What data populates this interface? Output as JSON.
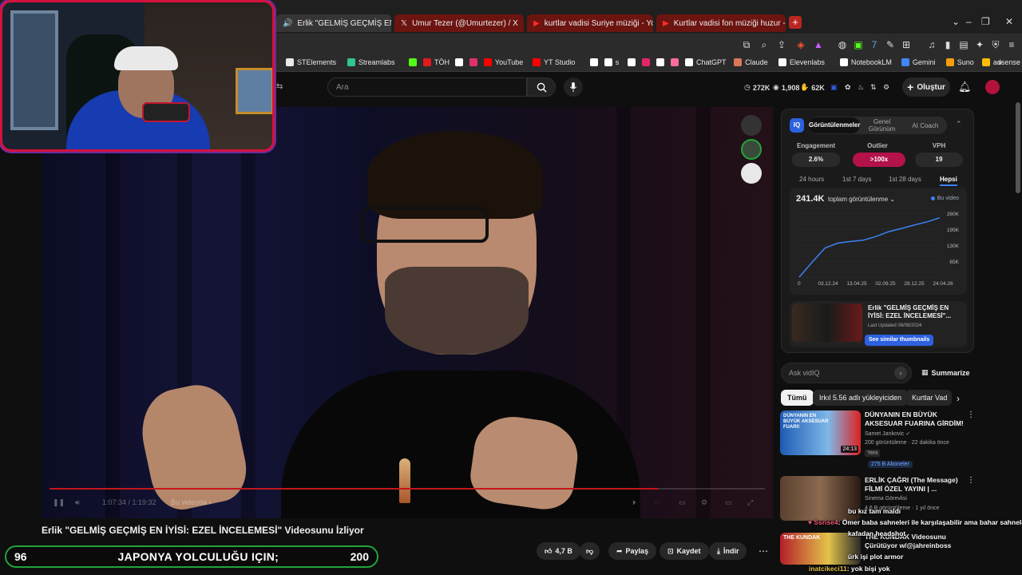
{
  "browser": {
    "tabs": [
      {
        "label": "Erlik \"GELMİŞ GEÇMİŞ EN İYİSİ",
        "icon": "speaker-icon",
        "active": true
      },
      {
        "label": "Umur Tezer (@Umurtezer) / X",
        "icon": "x-icon"
      },
      {
        "label": "kurtlar vadisi Suriye müziği - YouTube",
        "icon": "youtube-icon"
      },
      {
        "label": "Kurtlar vadisi fon müziği huzur - You",
        "icon": "youtube-icon"
      }
    ],
    "new_tab": "+",
    "window_controls": [
      "⌄",
      "–",
      "❐",
      "✕"
    ],
    "bookmarks": [
      {
        "label": "STElements",
        "color": "#e8e8e8"
      },
      {
        "label": "Streamlabs",
        "color": "#31c48d"
      },
      {
        "label": "",
        "color": "#53fc18"
      },
      {
        "label": "TÖH",
        "color": "#e21b1b"
      },
      {
        "label": "",
        "color": "#ffffff"
      },
      {
        "label": "",
        "color": "#e1306c"
      },
      {
        "label": "YouTube",
        "color": "#ff0000"
      },
      {
        "label": "YT Studio",
        "color": "#ff0000"
      },
      {
        "label": "",
        "color": "#ffffff"
      },
      {
        "label": "s",
        "color": "#ffffff"
      },
      {
        "label": "",
        "color": "#ffffff"
      },
      {
        "label": "",
        "color": "#e2246b"
      },
      {
        "label": "",
        "color": "#ffffff"
      },
      {
        "label": "",
        "color": "#ff6b9d"
      },
      {
        "label": "ChatGPT",
        "color": "#ffffff"
      },
      {
        "label": "Claude",
        "color": "#d97757"
      },
      {
        "label": "Elevenlabs",
        "color": "#ffffff"
      },
      {
        "label": "NotebookLM",
        "color": "#ffffff"
      },
      {
        "label": "Gemini",
        "color": "#4285f4"
      },
      {
        "label": "Suno",
        "color": "#f59e0b"
      },
      {
        "label": "adsense",
        "color": "#fbbc04"
      }
    ],
    "bookmarks_more": "»"
  },
  "youtube": {
    "search_placeholder": "Ara",
    "header_stats": [
      {
        "icon": "clock-icon",
        "value": "272K"
      },
      {
        "icon": "eye-icon",
        "value": "1,908"
      },
      {
        "icon": "thumb-icon",
        "value": "62K"
      }
    ],
    "create_label": "Oluştur",
    "video_title": "Erlik \"GELMİŞ GEÇMİŞ EN İYİSİ: EZEL İNCELEMESİ\" Videosunu İzliyor",
    "video_time": "1:07:34 / 1:19:32",
    "video_chapter": "Bu videoda ›",
    "progress": 0.85,
    "actions": {
      "like": "4,7 B",
      "share": "Paylaş",
      "save": "Kaydet",
      "download": "İndir"
    }
  },
  "ticker": {
    "left": "96",
    "text": "JAPONYA YOLCULUĞU IÇIN;",
    "right": "200",
    "border_color": "#21a33b"
  },
  "vidiq": {
    "logo": "IQ",
    "tabs": [
      "Görüntülenmeler",
      "Genel Görünüm",
      "AI Coach"
    ],
    "metrics": [
      {
        "label": "Engagement",
        "value": "2.6%"
      },
      {
        "label": "Outlier",
        "value": ">100x"
      },
      {
        "label": "VPH",
        "value": "19"
      }
    ],
    "periods": [
      "24 hours",
      "1st 7 days",
      "1st 28 days",
      "Hepsi"
    ],
    "total_views": "241.4K",
    "views_dropdown": "toplam görüntülenme",
    "legend": "Bu video",
    "related_title": "Erlik \"GELMİŞ GEÇMİŞ EN İYİSİ: EZEL İNCELEMESİ\"...",
    "related_updated": "Last Updated 08/08/2024",
    "related_button": "See similar thumbnails",
    "ask_placeholder": "Ask vidIQ",
    "summarize": "Summarize"
  },
  "chart_data": {
    "type": "line",
    "x": [
      "03.12.24",
      "13.04.25",
      "02.09.25",
      "28.12.25",
      "24.04.26"
    ],
    "y_ticks": [
      "0",
      "65K",
      "130K",
      "195K",
      "260K"
    ],
    "ylim": [
      0,
      260000
    ],
    "series": [
      {
        "name": "Bu video",
        "values": [
          0,
          60000,
          118000,
          138000,
          145000,
          150000,
          165000,
          185000,
          198000,
          212000,
          225000,
          241400
        ]
      }
    ]
  },
  "chips": [
    "Tümü",
    "Irkıl 5.56 adlı yükleyiciden",
    "Kurtlar Vad"
  ],
  "recommendations": [
    {
      "title": "DÜNYANIN EN BÜYÜK AKSESUAR FUARINA GİRDİM! ...",
      "channel": "Samet Jankovic ✓",
      "meta": "200 görüntüleme · 22 dakika önce",
      "badge": "Yeni",
      "subs": "275 B Aboneler",
      "duration": "24:13",
      "thumb_text": "DÜNYANIN EN BÜYÜK AKSESUAR FUARI!"
    },
    {
      "title": "ERLİK ÇAĞRI (The Message) FİLMİ ÖZEL YAYINI | ...",
      "channel": "Sinema Görevlisi",
      "meta": "4,6 B görüntüleme · 1 yıl önce",
      "badge": "",
      "subs": "",
      "duration": "",
      "thumb_text": ""
    },
    {
      "title": "THE KUNDAK Videosunu Çürütüyor w/@jahreinboss",
      "channel": "",
      "meta": "",
      "badge": "",
      "subs": "",
      "duration": "",
      "thumb_text": "THE KUNDAK"
    }
  ],
  "chat": [
    {
      "user": "",
      "text": "bu kız tam maldı"
    },
    {
      "user": "Ssrise4",
      "text": ": Ömer baba sahneleri ile karşılaşabilir ama bahar sahneleri"
    },
    {
      "user": "",
      "text": "kafadan headshot"
    },
    {
      "user": "",
      "text": "ürk işi plot armor"
    },
    {
      "user": "inatcikeci11",
      "text": ": yok bişi yok"
    }
  ],
  "ui": {
    "more_dots": "⋯",
    "kebab": "⋮",
    "chip_next": "›"
  }
}
